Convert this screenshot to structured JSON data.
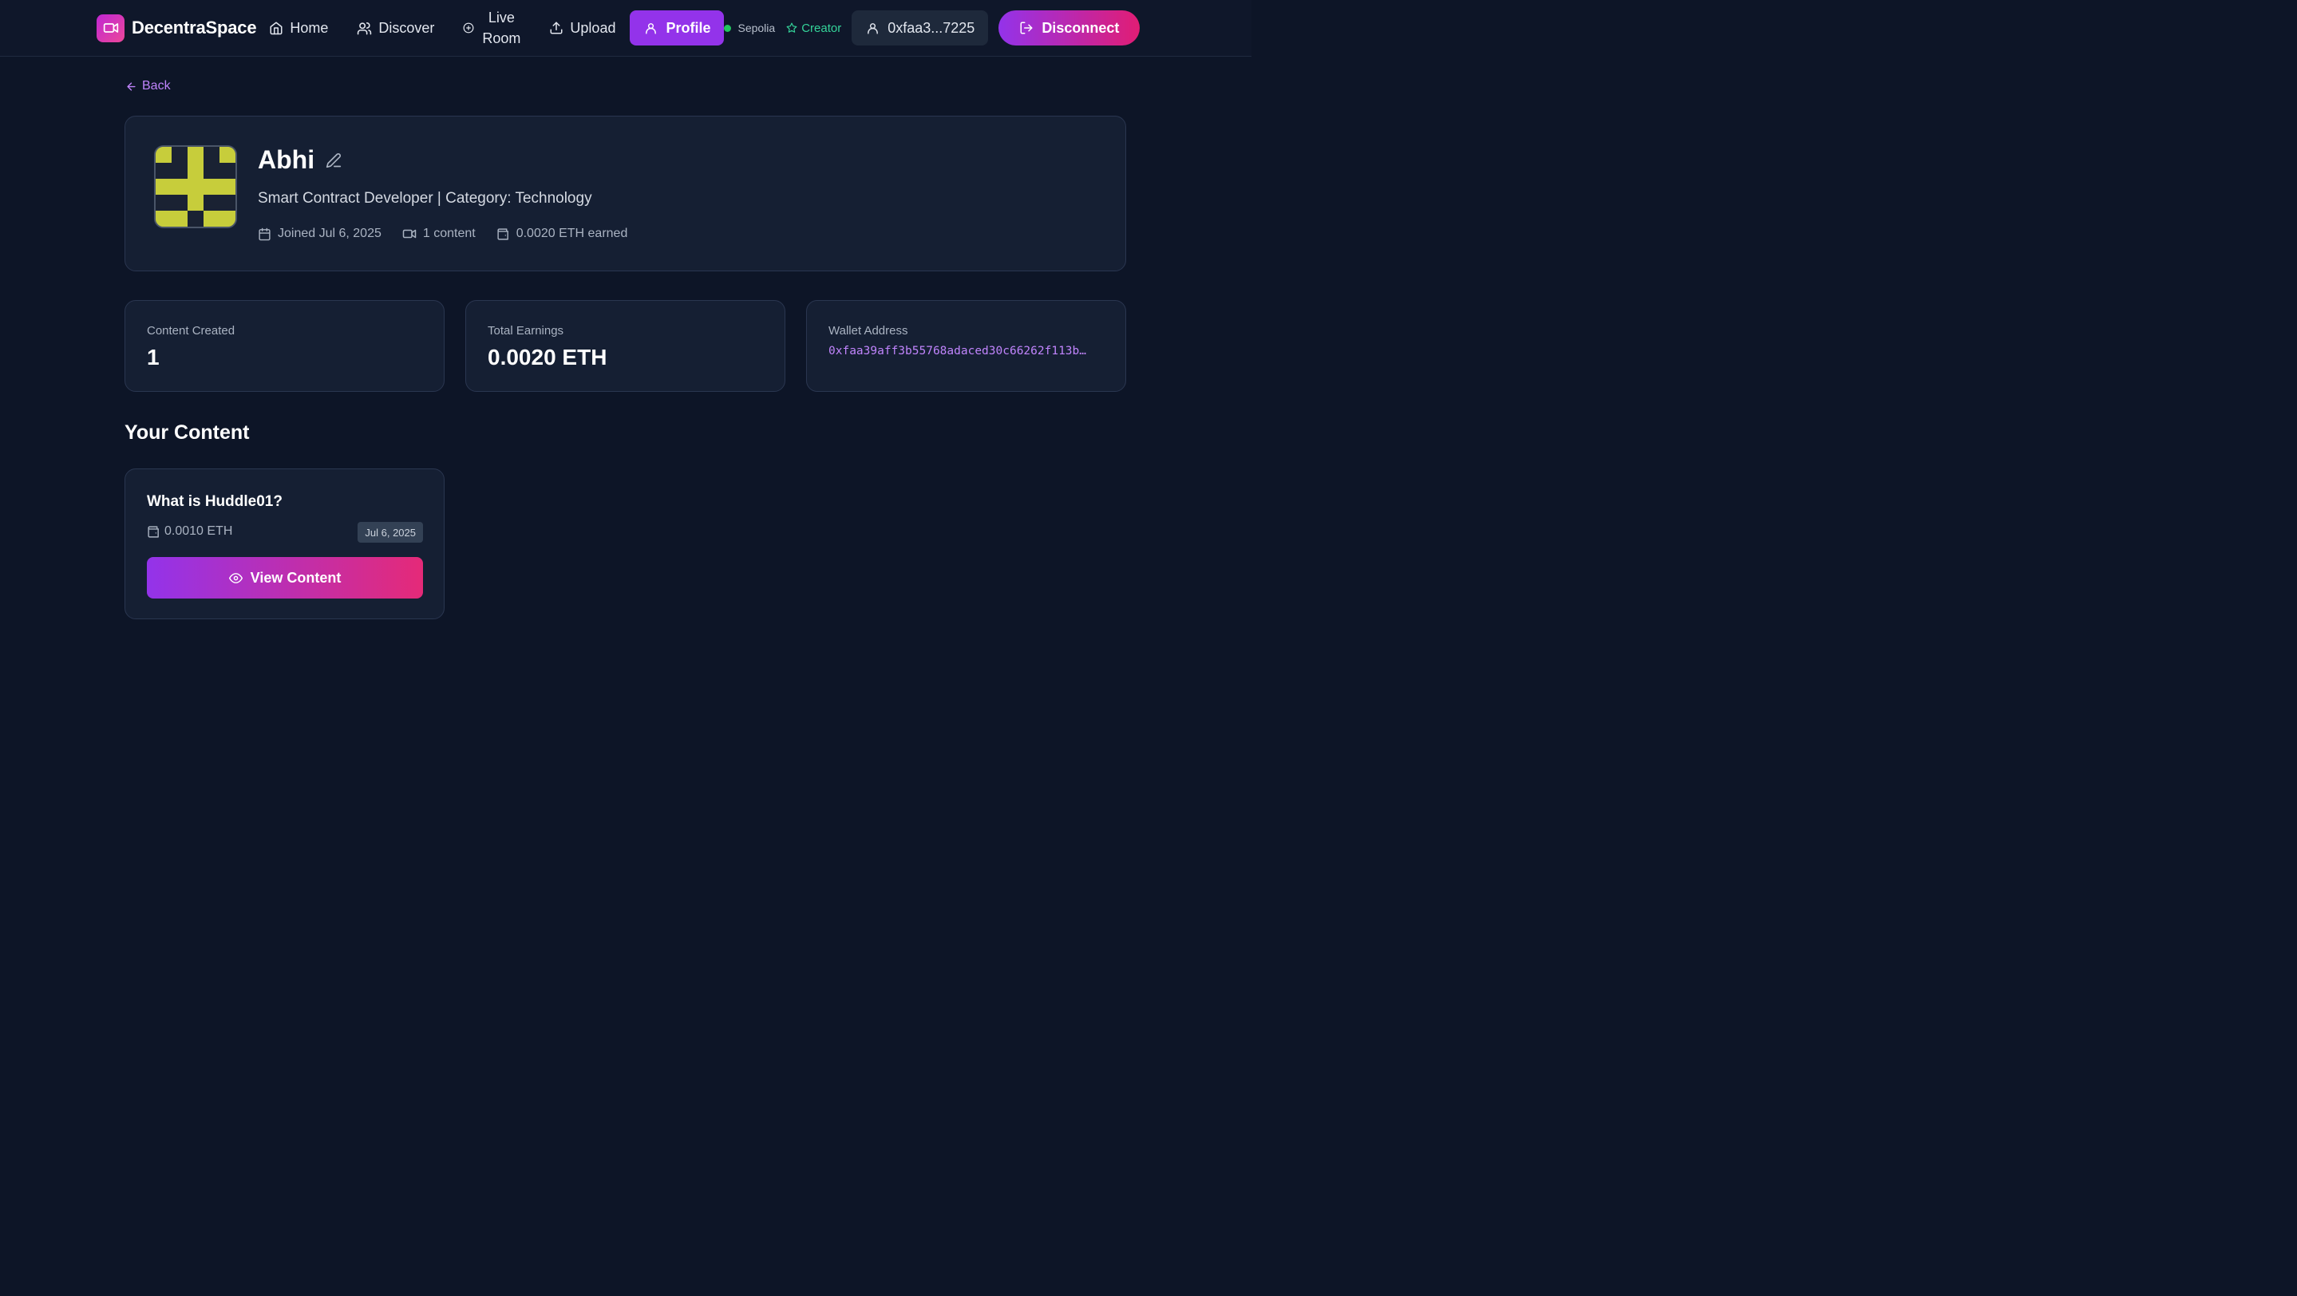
{
  "nav": {
    "brand": "DecentraSpace",
    "links": {
      "home": "Home",
      "discover": "Discover",
      "live_line1": "Live",
      "live_line2": "Room",
      "upload": "Upload",
      "profile": "Profile"
    },
    "network": "Sepolia",
    "role": "Creator",
    "wallet_short": "0xfaa3...7225",
    "disconnect": "Disconnect"
  },
  "back_label": "Back",
  "profile": {
    "name": "Abhi",
    "bio": "Smart Contract Developer | Category: Technology",
    "joined": "Joined Jul 6, 2025",
    "content_count": "1 content",
    "earned": "0.0020 ETH earned"
  },
  "stats": {
    "content_label": "Content Created",
    "content_value": "1",
    "earnings_label": "Total Earnings",
    "earnings_value": "0.0020 ETH",
    "wallet_label": "Wallet Address",
    "wallet_value": "0xfaa39aff3b55768adaced30c66262f113b…"
  },
  "your_content": {
    "title": "Your Content",
    "items": [
      {
        "title": "What is Huddle01?",
        "price": "0.0010 ETH",
        "date": "Jul 6, 2025",
        "action": "View Content"
      }
    ]
  },
  "colors": {
    "background": "#0d1527",
    "card": "#151f33",
    "accent_purple": "#9333ea",
    "accent_pink": "#e11d74",
    "link_purple": "#c084fc",
    "creator_green": "#34d399",
    "network_green": "#22c55e",
    "avatar_yellow": "#c7cd3b"
  },
  "icons": {
    "logo": "video-camera-icon",
    "home": "home-icon",
    "discover": "users-icon",
    "live": "plus-circle-icon",
    "upload": "upload-icon",
    "profile": "user-icon",
    "creator": "star-icon",
    "wallet": "user-icon",
    "disconnect": "log-out-icon",
    "back": "arrow-left-icon",
    "edit": "pencil-icon",
    "joined": "calendar-icon",
    "content": "video-icon",
    "earned": "wallet-icon",
    "view": "eye-icon"
  }
}
